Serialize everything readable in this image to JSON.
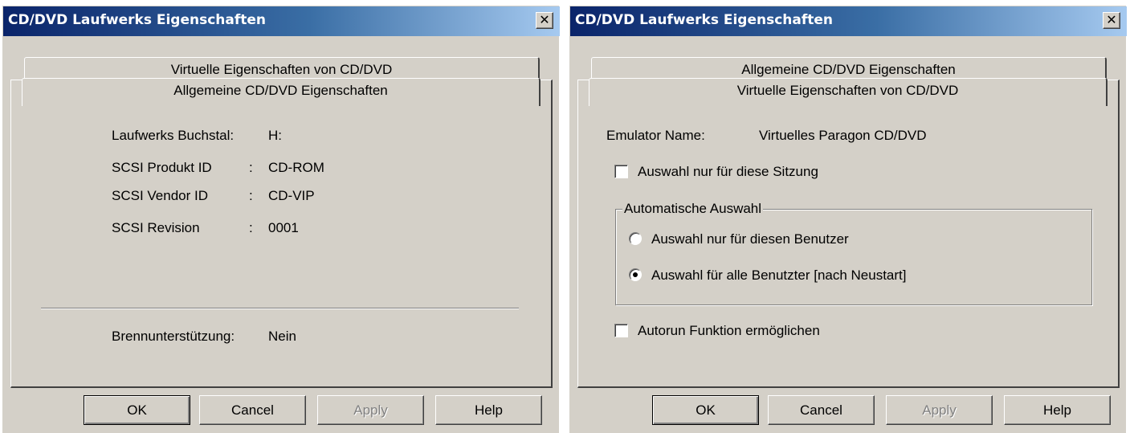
{
  "left": {
    "title": "CD/DVD Laufwerks Eigenschaften",
    "close_glyph": "✕",
    "tab_back": "Virtuelle Eigenschaften von CD/DVD",
    "tab_front": "Allgemeine CD/DVD Eigenschaften",
    "rows": [
      {
        "label": "Laufwerks Buchstal:",
        "colon": "",
        "value": "H:"
      },
      {
        "label": "SCSI Produkt ID",
        "colon": ":",
        "value": "CD-ROM"
      },
      {
        "label": "SCSI Vendor ID",
        "colon": ":",
        "value": "CD-VIP"
      },
      {
        "label": "SCSI Revision",
        "colon": ":",
        "value": "0001"
      }
    ],
    "burn_label": "Brennunterstützung:",
    "burn_value": "Nein",
    "buttons": {
      "ok": "OK",
      "cancel": "Cancel",
      "apply": "Apply",
      "help": "Help"
    }
  },
  "right": {
    "title": "CD/DVD Laufwerks Eigenschaften",
    "close_glyph": "✕",
    "tab_back": "Allgemeine CD/DVD Eigenschaften",
    "tab_front": "Virtuelle Eigenschaften von CD/DVD",
    "emulator_label": "Emulator Name:",
    "emulator_value": "Virtuelles Paragon CD/DVD",
    "session_checkbox": {
      "label": "Auswahl nur für diese Sitzung",
      "checked": false
    },
    "group_title": "Automatische Auswahl",
    "radio_user": {
      "label": "Auswahl nur für diesen Benutzer",
      "selected": false
    },
    "radio_all": {
      "label": "Auswahl für alle Benutzter [nach Neustart]",
      "selected": true
    },
    "autorun_checkbox": {
      "label": "Autorun Funktion ermöglichen",
      "checked": false
    },
    "buttons": {
      "ok": "OK",
      "cancel": "Cancel",
      "apply": "Apply",
      "help": "Help"
    }
  },
  "colors": {
    "dialog_bg": "#d4d0c8",
    "titlebar_start": "#0a246a",
    "titlebar_end": "#a6caf0",
    "disabled_text": "#808080"
  }
}
